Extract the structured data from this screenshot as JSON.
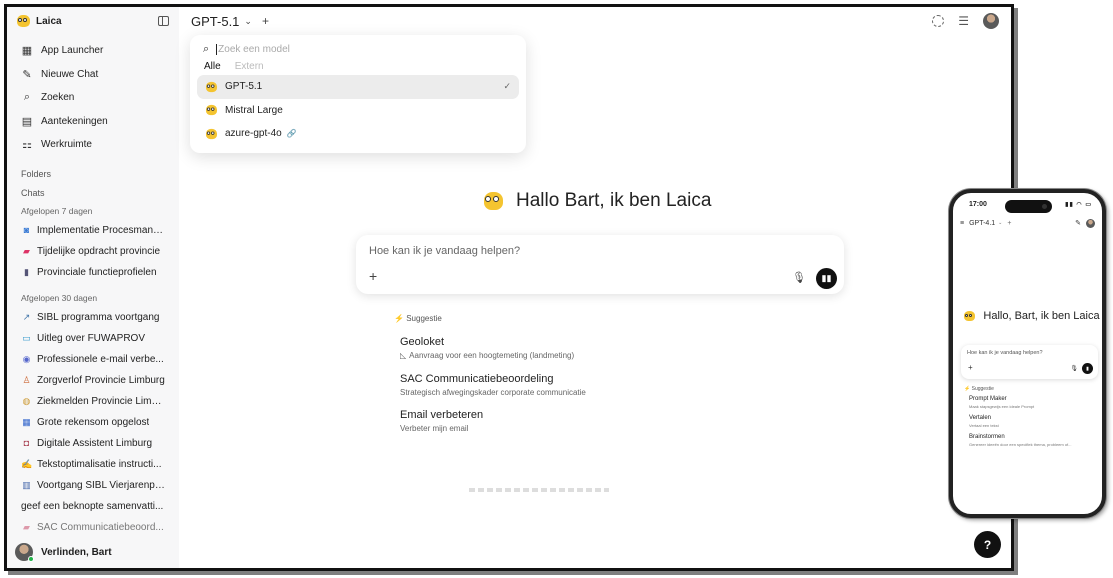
{
  "app_name": "Laica",
  "sidebar": {
    "nav": [
      {
        "icon": "grid-icon",
        "label": "App Launcher"
      },
      {
        "icon": "edit-icon",
        "label": "Nieuwe Chat"
      },
      {
        "icon": "search-icon",
        "label": "Zoeken"
      },
      {
        "icon": "notes-icon",
        "label": "Aantekeningen"
      },
      {
        "icon": "workspace-icon",
        "label": "Werkruimte"
      }
    ],
    "folders_label": "Folders",
    "chats_label": "Chats",
    "last7_label": "Afgelopen 7 dagen",
    "last7": [
      "Implementatie Procesmana...",
      "Tijdelijke opdracht provincie",
      "Provinciale functieprofielen"
    ],
    "last30_label": "Afgelopen 30 dagen",
    "last30": [
      "SIBL programma voortgang",
      "Uitleg over FUWAPROV",
      "Professionele e-mail verbe...",
      "Zorgverlof Provincie Limburg",
      "Ziekmelden Provincie Limb...",
      "Grote rekensom opgelost",
      "Digitale Assistent Limburg",
      "Tekstoptimalisatie instructi...",
      "Voortgang SIBL Vierjarenpl...",
      "geef een beknopte samenvatti...",
      "SAC Communicatiebeoord..."
    ],
    "user_name": "Verlinden, Bart"
  },
  "topbar": {
    "model": "GPT-5.1",
    "chev": "⌄",
    "plus": "+"
  },
  "model_dropdown": {
    "search_placeholder": "Zoek een model",
    "tab_all": "Alle",
    "tab_external": "Extern",
    "models": [
      "GPT-5.1",
      "Mistral Large",
      "azure-gpt-4o"
    ],
    "selected": "GPT-5.1"
  },
  "greeting": "Hallo Bart, ik ben Laica",
  "prompt_placeholder": "Hoe kan ik je vandaag helpen?",
  "suggestion_label": "Suggestie",
  "suggestions": [
    {
      "title": "Geoloket",
      "sub": "Aanvraag voor een hoogtemeting (landmeting)"
    },
    {
      "title": "SAC Communicatiebeoordeling",
      "sub": "Strategisch afwegingskader corporate communicatie"
    },
    {
      "title": "Email verbeteren",
      "sub": "Verbeter mijn email"
    }
  ],
  "help_label": "?",
  "phone": {
    "time": "17:00",
    "model": "GPT-4.1",
    "greeting": "Hallo, Bart, ik ben Laica",
    "prompt_placeholder": "Hoe kan ik je vandaag helpen?",
    "suggestion_label": "Suggestie",
    "suggestions": [
      {
        "title": "Prompt Maker",
        "sub": "Maak stapsgewijs een ideale Prompt"
      },
      {
        "title": "Vertalen",
        "sub": "Vertaal een tekst"
      },
      {
        "title": "Brainstormen",
        "sub": "Genereer ideeën door een specifiek thema, probleem of..."
      }
    ]
  }
}
